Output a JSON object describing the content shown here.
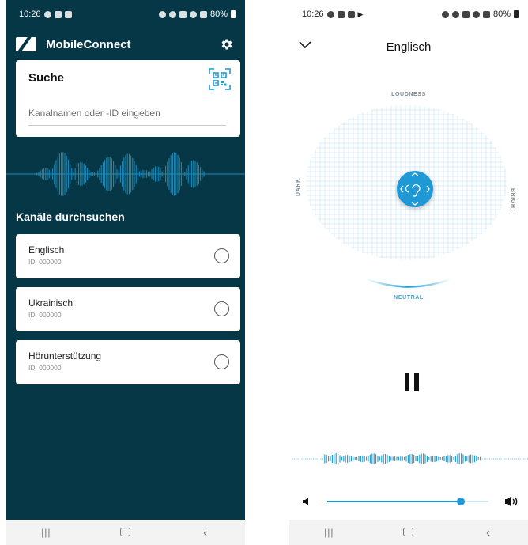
{
  "left": {
    "status": {
      "time": "10:26",
      "battery": "80%"
    },
    "app_title": "MobileConnect",
    "search": {
      "title": "Suche",
      "placeholder": "Kanalnamen oder -ID eingeben"
    },
    "section_title": "Kanäle durchsuchen",
    "channels": [
      {
        "name": "Englisch",
        "id": "ID: 000000"
      },
      {
        "name": "Ukrainisch",
        "id": "ID: 000000"
      },
      {
        "name": "Hörunterstützung",
        "id": "ID: 000000"
      }
    ]
  },
  "right": {
    "status": {
      "time": "10:26",
      "battery": "80%"
    },
    "title": "Englisch",
    "labels": {
      "top": "LOUDNESS",
      "left": "DARK",
      "right": "BRIGHT",
      "bottom": "NEUTRAL"
    },
    "volume": 0.83
  },
  "icons": {
    "settings": "gear-icon",
    "qr": "qr-code-icon",
    "back": "chevron-down-icon",
    "pause": "pause-icon",
    "volume_low": "volume-low-icon",
    "volume_high": "volume-high-icon",
    "hearing": "ear-icon"
  },
  "colors": {
    "brand_dark": "#063746",
    "accent": "#1f98d6",
    "wave": "#1c8fbf"
  }
}
